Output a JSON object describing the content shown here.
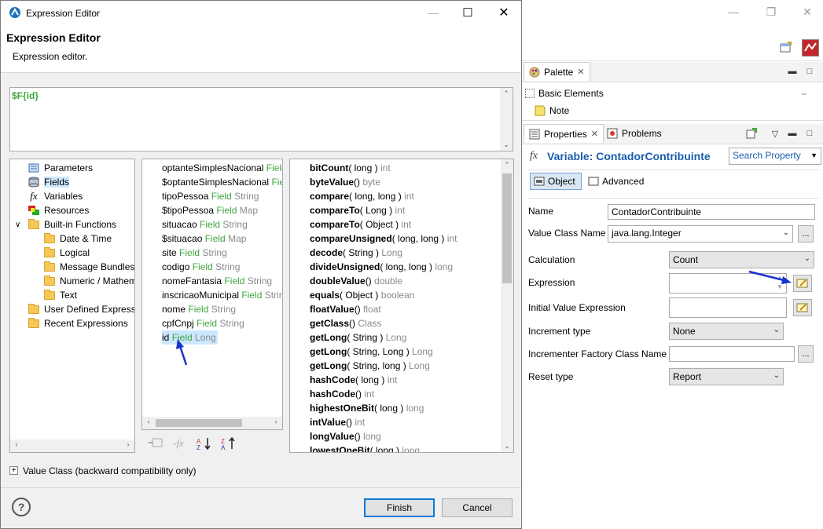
{
  "dialog": {
    "window_title": "Expression Editor",
    "header_title": "Expression Editor",
    "header_subtitle": "Expression editor.",
    "expression_text": "$F{id}",
    "categories": [
      {
        "label": "Parameters",
        "icon": "parameters-icon",
        "indent": 0
      },
      {
        "label": "Fields",
        "icon": "fields-icon",
        "indent": 0,
        "selected": true
      },
      {
        "label": "Variables",
        "icon": "variables-icon",
        "indent": 0
      },
      {
        "label": "Resources",
        "icon": "resources-icon",
        "indent": 0
      },
      {
        "label": "Built-in Functions",
        "icon": "folder-icon",
        "indent": 0,
        "expanded": true
      },
      {
        "label": "Date & Time",
        "icon": "folder-icon",
        "indent": 1
      },
      {
        "label": "Logical",
        "icon": "folder-icon",
        "indent": 1
      },
      {
        "label": "Message Bundles",
        "icon": "folder-icon",
        "indent": 1
      },
      {
        "label": "Numeric / Mathem",
        "icon": "folder-icon",
        "indent": 1
      },
      {
        "label": "Text",
        "icon": "folder-icon",
        "indent": 1
      },
      {
        "label": "User Defined Expressi",
        "icon": "folder-icon",
        "indent": 0
      },
      {
        "label": "Recent Expressions",
        "icon": "folder-icon",
        "indent": 0
      }
    ],
    "fields": [
      {
        "name": "optanteSimplesNacional",
        "kind": "Field",
        "type": ""
      },
      {
        "name": "$optanteSimplesNacional",
        "kind": "Fie",
        "type": ""
      },
      {
        "name": "tipoPessoa",
        "kind": "Field",
        "type": "String"
      },
      {
        "name": "$tipoPessoa",
        "kind": "Field",
        "type": "Map"
      },
      {
        "name": "situacao",
        "kind": "Field",
        "type": "String"
      },
      {
        "name": "$situacao",
        "kind": "Field",
        "type": "Map"
      },
      {
        "name": "site",
        "kind": "Field",
        "type": "String"
      },
      {
        "name": "codigo",
        "kind": "Field",
        "type": "String"
      },
      {
        "name": "nomeFantasia",
        "kind": "Field",
        "type": "String"
      },
      {
        "name": "inscricaoMunicipal",
        "kind": "Field",
        "type": "Strir"
      },
      {
        "name": "nome",
        "kind": "Field",
        "type": "String"
      },
      {
        "name": "cpfCnpj",
        "kind": "Field",
        "type": "String"
      },
      {
        "name": "id",
        "kind": "Field",
        "type": "Long",
        "selected": true
      }
    ],
    "methods": [
      {
        "name": "bitCount",
        "args": "( long )",
        "ret": "int"
      },
      {
        "name": "byteValue",
        "args": "()",
        "ret": "byte"
      },
      {
        "name": "compare",
        "args": "( long, long )",
        "ret": "int"
      },
      {
        "name": "compareTo",
        "args": "( Long )",
        "ret": "int"
      },
      {
        "name": "compareTo",
        "args": "( Object )",
        "ret": "int"
      },
      {
        "name": "compareUnsigned",
        "args": "( long, long )",
        "ret": "int"
      },
      {
        "name": "decode",
        "args": "( String )",
        "ret": "Long"
      },
      {
        "name": "divideUnsigned",
        "args": "( long, long )",
        "ret": "long"
      },
      {
        "name": "doubleValue",
        "args": "()",
        "ret": "double"
      },
      {
        "name": "equals",
        "args": "( Object )",
        "ret": "boolean"
      },
      {
        "name": "floatValue",
        "args": "()",
        "ret": "float"
      },
      {
        "name": "getClass",
        "args": "()",
        "ret": "Class"
      },
      {
        "name": "getLong",
        "args": "( String )",
        "ret": "Long"
      },
      {
        "name": "getLong",
        "args": "( String, Long )",
        "ret": "Long"
      },
      {
        "name": "getLong",
        "args": "( String, long )",
        "ret": "Long"
      },
      {
        "name": "hashCode",
        "args": "( long )",
        "ret": "int"
      },
      {
        "name": "hashCode",
        "args": "()",
        "ret": "int"
      },
      {
        "name": "highestOneBit",
        "args": "( long )",
        "ret": "long"
      },
      {
        "name": "intValue",
        "args": "()",
        "ret": "int"
      },
      {
        "name": "longValue",
        "args": "()",
        "ret": "long"
      },
      {
        "name": "lowestOneBit",
        "args": "( long )",
        "ret": "long"
      }
    ],
    "value_class_label": "Value Class (backward compatibility only)",
    "expand_symbol": "+",
    "finish_label": "Finish",
    "cancel_label": "Cancel",
    "help_symbol": "?"
  },
  "right_panel": {
    "palette_tab": "Palette",
    "palette_section": "Basic Elements",
    "palette_item": "Note",
    "properties_tab": "Properties",
    "problems_tab": "Problems",
    "variable_title": "Variable: ContadorContribuinte",
    "search_placeholder": "Search Property",
    "tab_object": "Object",
    "tab_advanced": "Advanced",
    "props": {
      "name_label": "Name",
      "name_value": "ContadorContribuinte",
      "value_class_label": "Value Class Name",
      "value_class_value": "java.lang.Integer",
      "calculation_label": "Calculation",
      "calculation_value": "Count",
      "expression_label": "Expression",
      "initial_label": "Initial Value Expression",
      "increment_type_label": "Increment type",
      "increment_type_value": "None",
      "incrementer_label": "Incrementer Factory Class Name",
      "reset_type_label": "Reset type",
      "reset_type_value": "Report",
      "dots": "..."
    }
  },
  "colors": {
    "accent": "#0078d7",
    "title_blue": "#1b5dab",
    "field_green": "#3fa63f",
    "type_gray": "#8a8a8a",
    "selection": "#cce8ff",
    "arrow_blue": "#1a33cc"
  }
}
